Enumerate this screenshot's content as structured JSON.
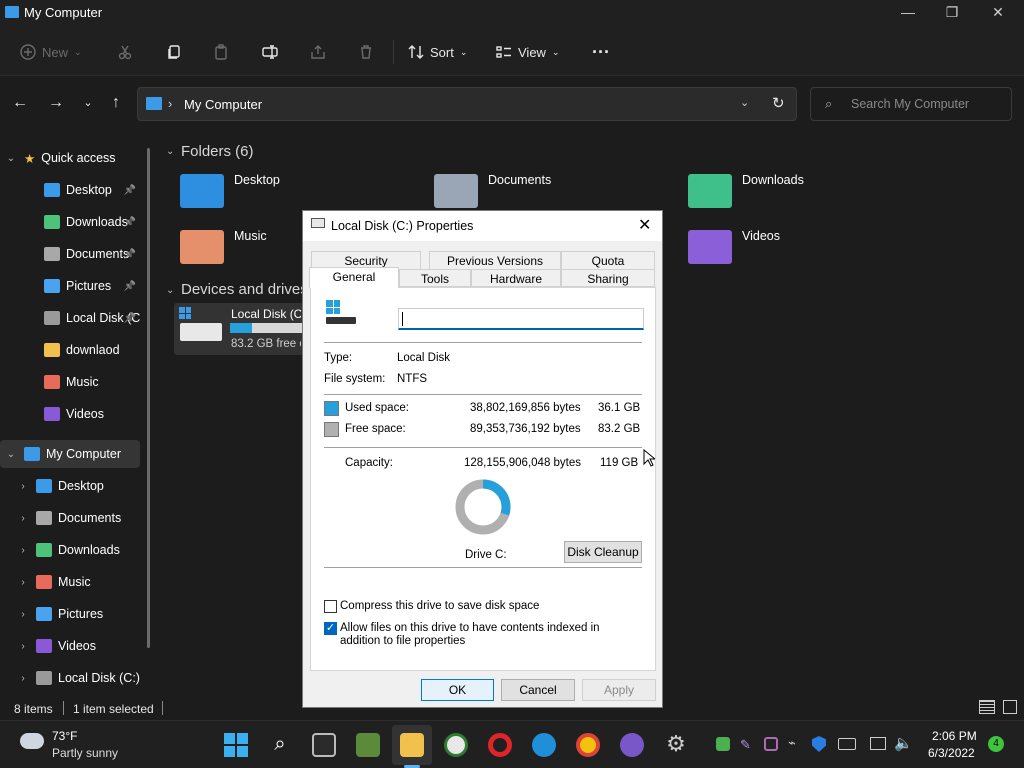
{
  "window": {
    "title": "My Computer",
    "minimize": "—",
    "maximize": "❐",
    "close": "✕"
  },
  "toolbar": {
    "new_label": "New",
    "sort_label": "Sort",
    "view_label": "View",
    "more": "···"
  },
  "address": {
    "path": "My Computer",
    "separator": "›",
    "search_placeholder": "Search My Computer"
  },
  "nav_pane": {
    "quick_access_label": "Quick access",
    "quick_items": [
      {
        "label": "Desktop",
        "icon": "desktop-icon",
        "color": "#3c9be8"
      },
      {
        "label": "Downloads",
        "icon": "downloads-icon",
        "color": "#4cc27b"
      },
      {
        "label": "Documents",
        "icon": "documents-icon",
        "color": "#a8a8a8"
      },
      {
        "label": "Pictures",
        "icon": "pictures-icon",
        "color": "#4aa3ef"
      },
      {
        "label": "Local Disk (C:)",
        "icon": "drive-icon",
        "color": "#9a9a9a"
      },
      {
        "label": "downlaod",
        "icon": "folder-icon",
        "color": "#f2c04d"
      },
      {
        "label": "Music",
        "icon": "music-icon",
        "color": "#e86a5a"
      },
      {
        "label": "Videos",
        "icon": "videos-icon",
        "color": "#8a5ad6"
      }
    ],
    "my_computer_label": "My Computer",
    "computer_items": [
      {
        "label": "Desktop",
        "icon": "desktop-icon",
        "color": "#3c9be8"
      },
      {
        "label": "Documents",
        "icon": "documents-icon",
        "color": "#a8a8a8"
      },
      {
        "label": "Downloads",
        "icon": "downloads-icon",
        "color": "#4cc27b"
      },
      {
        "label": "Music",
        "icon": "music-icon",
        "color": "#e86a5a"
      },
      {
        "label": "Pictures",
        "icon": "pictures-icon",
        "color": "#4aa3ef"
      },
      {
        "label": "Videos",
        "icon": "videos-icon",
        "color": "#8a5ad6"
      },
      {
        "label": "Local Disk (C:)",
        "icon": "drive-icon",
        "color": "#9a9a9a"
      }
    ]
  },
  "content": {
    "folders_header": "Folders (6)",
    "folders": [
      {
        "name": "Desktop",
        "color": "#2e8fe0"
      },
      {
        "name": "Documents",
        "color": "#9aa6b6"
      },
      {
        "name": "Downloads",
        "color": "#3fbf8a"
      },
      {
        "name": "Music",
        "color": "#e58f6b"
      },
      {
        "name": "Videos",
        "color": "#8b5fd8"
      }
    ],
    "devices_header": "Devices and drives",
    "drive": {
      "name": "Local Disk (C:)",
      "free_text": "83.2 GB free of 119 GB",
      "used_fraction": 0.3
    }
  },
  "status": {
    "items": "8 items",
    "selected": "1 item selected"
  },
  "dialog": {
    "title": "Local Disk (C:) Properties",
    "tabs_row1": [
      "Security",
      "Previous Versions",
      "Quota"
    ],
    "tabs_row2": [
      "General",
      "Tools",
      "Hardware",
      "Sharing"
    ],
    "active_tab": "General",
    "label_value": "",
    "type_label": "Type:",
    "type_value": "Local Disk",
    "fs_label": "File system:",
    "fs_value": "NTFS",
    "used_label": "Used space:",
    "used_bytes": "38,802,169,856 bytes",
    "used_gb": "36.1 GB",
    "free_label": "Free space:",
    "free_bytes": "89,353,736,192 bytes",
    "free_gb": "83.2 GB",
    "capacity_label": "Capacity:",
    "capacity_bytes": "128,155,906,048 bytes",
    "capacity_gb": "119 GB",
    "used_fraction": 0.3,
    "used_color": "#26a0da",
    "free_color": "#b0b0b0",
    "drive_label": "Drive C:",
    "cleanup_label": "Disk Cleanup",
    "compress_label": "Compress this drive to save disk space",
    "compress_checked": false,
    "index_label": "Allow files on this drive to have contents indexed in addition to file properties",
    "index_checked": true,
    "ok_label": "OK",
    "cancel_label": "Cancel",
    "apply_label": "Apply"
  },
  "taskbar": {
    "weather_temp": "73°F",
    "weather_desc": "Partly sunny",
    "time": "2:06 PM",
    "date": "6/3/2022",
    "notif_count": "4"
  }
}
